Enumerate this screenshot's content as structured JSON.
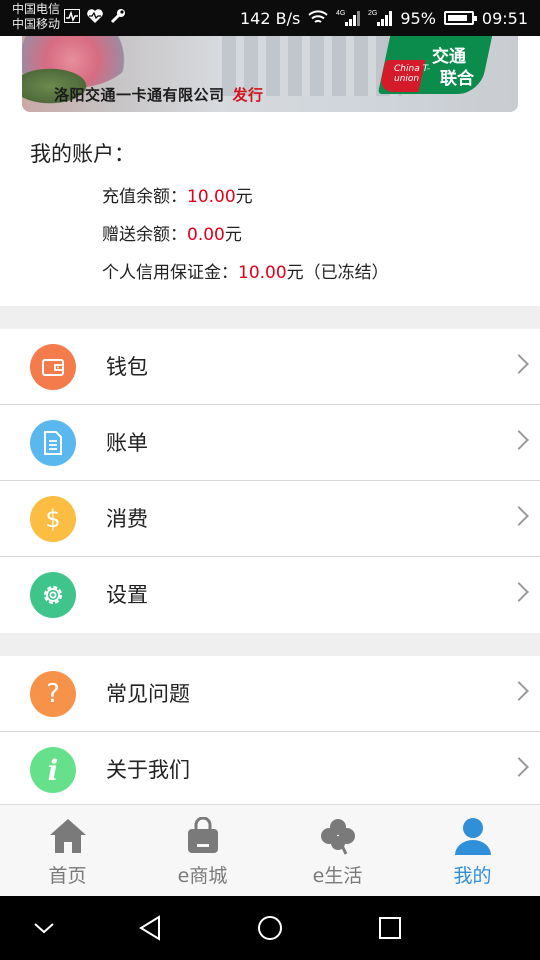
{
  "statusbar": {
    "carrier1": "中国电信",
    "carrier2": "中国移动",
    "speed": "142 B/s",
    "battery": "95%",
    "time": "09:51"
  },
  "banner": {
    "issuer": "洛阳交通一卡通有限公司",
    "issued": "发行",
    "logo_cn_1": "交通",
    "logo_cn_2": "联合",
    "logo_en": "China T-union"
  },
  "account": {
    "title": "我的账户：",
    "recharge_label": "充值余额：",
    "recharge_value": "10.00",
    "recharge_unit": "元",
    "gift_label": "赠送余额：",
    "gift_value": "0.00",
    "gift_unit": "元",
    "deposit_label": "个人信用保证金：",
    "deposit_value": "10.00",
    "deposit_unit": "元（已冻结）"
  },
  "menu1": [
    {
      "label": "钱包",
      "icon": "wallet-icon",
      "color": "#f47b4b"
    },
    {
      "label": "账单",
      "icon": "bill-icon",
      "color": "#5bb8ef"
    },
    {
      "label": "消费",
      "icon": "dollar-icon",
      "color": "#fbbd42"
    },
    {
      "label": "设置",
      "icon": "gear-icon",
      "color": "#3fc48c"
    }
  ],
  "menu2": [
    {
      "label": "常见问题",
      "icon": "question-icon",
      "color": "#f6924a"
    },
    {
      "label": "关于我们",
      "icon": "info-icon",
      "color": "#66e08a"
    }
  ],
  "nav": {
    "home": "首页",
    "mall": "e商城",
    "life": "e生活",
    "mine": "我的",
    "active_color": "#2f8fd8",
    "inactive_color": "#7a7a7a"
  }
}
